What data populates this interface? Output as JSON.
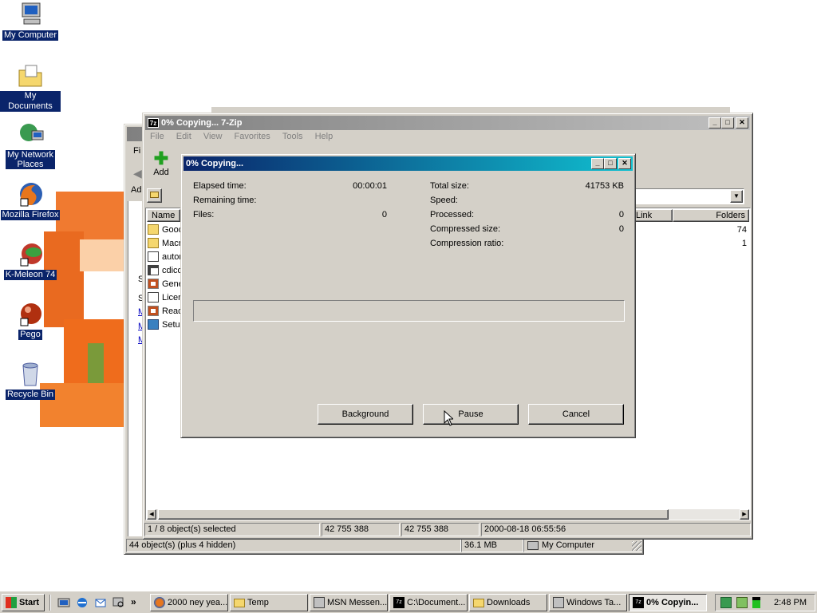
{
  "desktop": {
    "icons": [
      {
        "label": "My Computer",
        "icon": "my-computer-icon"
      },
      {
        "label": "My Documents",
        "icon": "my-documents-icon"
      },
      {
        "label_line1": "My Network",
        "label_line2": "Places",
        "icon": "network-places-icon"
      },
      {
        "label": "Mozilla Firefox",
        "icon": "firefox-icon"
      },
      {
        "label": "K-Meleon 74",
        "icon": "k-meleon-icon"
      },
      {
        "label": "Pego",
        "icon": "pego-icon"
      },
      {
        "label": "Recycle Bin",
        "icon": "recycle-bin-icon"
      }
    ]
  },
  "explorer": {
    "status_objects": "44 object(s) (plus 4 hidden)",
    "status_size": "36.1 MB",
    "status_location": "My Computer",
    "menu_first": "Fi",
    "address_first": "Ad",
    "panel_letters": [
      "S",
      "S",
      "M",
      "M",
      "M"
    ]
  },
  "zip": {
    "title": "0% Copying... 7-Zip",
    "menu": [
      "File",
      "Edit",
      "View",
      "Favorites",
      "Tools",
      "Help"
    ],
    "toolbar_add": "Add",
    "columns": {
      "name": "Name",
      "link": "Link",
      "folders": "Folders"
    },
    "files": [
      {
        "name": "Good",
        "icon": "folder-icon"
      },
      {
        "name": "Macr",
        "icon": "folder-icon"
      },
      {
        "name": "autor",
        "icon": "text-file-icon"
      },
      {
        "name": "cdico",
        "icon": "image-file-icon"
      },
      {
        "name": "Gene",
        "icon": "document-icon"
      },
      {
        "name": "Licer",
        "icon": "text-file-icon"
      },
      {
        "name": "Read",
        "icon": "document-icon"
      },
      {
        "name": "Setu",
        "icon": "setup-icon"
      }
    ],
    "folder_values": [
      "74",
      "1"
    ],
    "status": [
      "1 / 8 object(s) selected",
      "42 755 388",
      "42 755 388",
      "2000-08-18 06:55:56"
    ]
  },
  "dialog": {
    "title": "0% Copying...",
    "elapsed_label": "Elapsed time:",
    "elapsed_value": "00:00:01",
    "remaining_label": "Remaining time:",
    "files_label": "Files:",
    "files_value": "0",
    "total_label": "Total size:",
    "total_value": "41753 KB",
    "speed_label": "Speed:",
    "processed_label": "Processed:",
    "processed_value": "0",
    "compressed_label": "Compressed size:",
    "compressed_value": "0",
    "ratio_label": "Compression ratio:",
    "progress": 0,
    "buttons": {
      "background": "Background",
      "pause": "Pause",
      "cancel": "Cancel"
    }
  },
  "taskbar": {
    "start": "Start",
    "tasks": [
      {
        "label": "2000 ney yea...",
        "icon": "firefox-icon"
      },
      {
        "label": "Temp",
        "icon": "folder-icon"
      },
      {
        "label": "MSN Messen...",
        "icon": "msn-icon"
      },
      {
        "label": "C:\\Document...",
        "icon": "7zip-icon"
      },
      {
        "label": "Downloads",
        "icon": "folder-icon"
      },
      {
        "label": "Windows Ta...",
        "icon": "task-manager-icon"
      },
      {
        "label": "0% Copyin...",
        "icon": "7zip-icon"
      }
    ],
    "clock": "2:48 PM"
  }
}
